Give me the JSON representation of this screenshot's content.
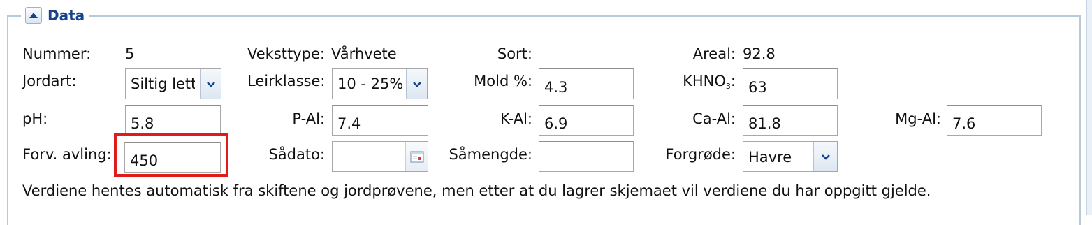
{
  "fieldset": {
    "title": "Data"
  },
  "row1": {
    "nummer_label": "Nummer:",
    "nummer_value": "5",
    "veksttype_label": "Veksttype:",
    "veksttype_value": "Vårhvete",
    "sort_label": "Sort:",
    "sort_value": "",
    "areal_label": "Areal:",
    "areal_value": "92.8"
  },
  "row2": {
    "jordart_label": "Jordart:",
    "jordart_value": "Siltig lett",
    "leirklasse_label": "Leirklasse:",
    "leirklasse_value": "10 - 25%",
    "mold_label": "Mold %:",
    "mold_value": "4.3",
    "khno_label_main": "KHNO",
    "khno_label_sub": "3",
    "khno_label_end": ":",
    "khno_value": "63"
  },
  "row3": {
    "ph_label": "pH:",
    "ph_value": "5.8",
    "pal_label": "P-Al:",
    "pal_value": "7.4",
    "kal_label": "K-Al:",
    "kal_value": "6.9",
    "caal_label": "Ca-Al:",
    "caal_value": "81.8",
    "mgal_label": "Mg-Al:",
    "mgal_value": "7.6"
  },
  "row4": {
    "avling_label": "Forv. avling:",
    "avling_value": "450",
    "sadato_label": "Sådato:",
    "sadato_value": "",
    "samengde_label": "Såmengde:",
    "samengde_value": "",
    "forgrode_label": "Forgrøde:",
    "forgrode_value": "Havre"
  },
  "note": "Verdiene hentes automatisk fra skiftene og jordprøvene, men etter at du lagrer skjemaet vil verdiene du har oppgitt gjelde.",
  "colors": {
    "legend": "#15428b",
    "highlight": "#e01b1b",
    "border": "#b8c9da"
  },
  "icons": {
    "toggle": "collapse-up-icon",
    "combo": "chevron-down-icon",
    "date": "calendar-icon"
  }
}
